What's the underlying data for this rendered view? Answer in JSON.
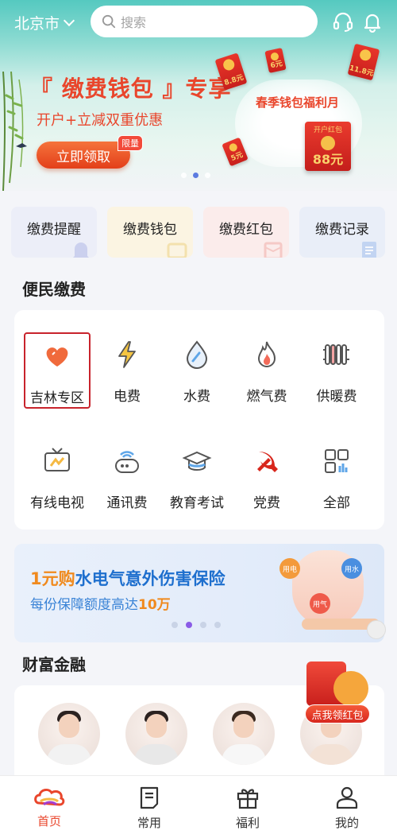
{
  "header": {
    "city": "北京市",
    "search_placeholder": "搜索"
  },
  "banner": {
    "title": "『 缴费钱包 』专享",
    "subtitle": "开户+立减双重优惠",
    "cta_label": "立即领取",
    "limited_badge": "限量",
    "event_title": "春季钱包福利月",
    "packet_label": "开户红包",
    "packet_amount": "88元",
    "small_packets": [
      "8.8元",
      "6元",
      "11.8元",
      "5元"
    ],
    "carousel_dots": 3,
    "carousel_active": 2
  },
  "quick_tiles": [
    {
      "label": "缴费提醒",
      "color": "#eceef8",
      "icon": "bell-icon"
    },
    {
      "label": "缴费钱包",
      "color": "#fbf4e2",
      "icon": "wallet-icon"
    },
    {
      "label": "缴费红包",
      "color": "#fbeceb",
      "icon": "envelope-icon"
    },
    {
      "label": "缴费记录",
      "color": "#e9eef8",
      "icon": "list-icon"
    }
  ],
  "payments": {
    "title": "便民缴费",
    "items": [
      {
        "label": "吉林专区",
        "icon": "heart-icon",
        "selected": true
      },
      {
        "label": "电费",
        "icon": "lightning-icon"
      },
      {
        "label": "水费",
        "icon": "water-drop-icon"
      },
      {
        "label": "燃气费",
        "icon": "flame-icon"
      },
      {
        "label": "供暖费",
        "icon": "radiator-icon"
      },
      {
        "label": "有线电视",
        "icon": "tv-icon"
      },
      {
        "label": "通讯费",
        "icon": "phone-wifi-icon"
      },
      {
        "label": "教育考试",
        "icon": "graduation-cap-icon"
      },
      {
        "label": "党费",
        "icon": "party-emblem-icon"
      },
      {
        "label": "全部",
        "icon": "grid-icon"
      }
    ]
  },
  "insurance": {
    "title_highlight": "1元购",
    "title_rest": "水电气意外伤害保险",
    "sub_prefix": "每份保障额度高达",
    "sub_amount": "10万",
    "bubble_electric": "用电",
    "bubble_water": "用水",
    "bubble_gas": "用气",
    "dots": 4,
    "active_dot": 2
  },
  "wealth": {
    "title": "财富金融"
  },
  "floating_packet": {
    "label": "点我领红包"
  },
  "tabs": [
    {
      "label": "首页",
      "icon": "home-cloud-icon",
      "active": true
    },
    {
      "label": "常用",
      "icon": "bookmark-doc-icon"
    },
    {
      "label": "福利",
      "icon": "gift-icon"
    },
    {
      "label": "我的",
      "icon": "user-icon"
    }
  ],
  "colors": {
    "accent": "#e9462c",
    "header_teal": "#55c9c0",
    "insurance_blue": "#1e6fce",
    "insurance_orange": "#f08a1e",
    "selected_border": "#c8232c"
  }
}
